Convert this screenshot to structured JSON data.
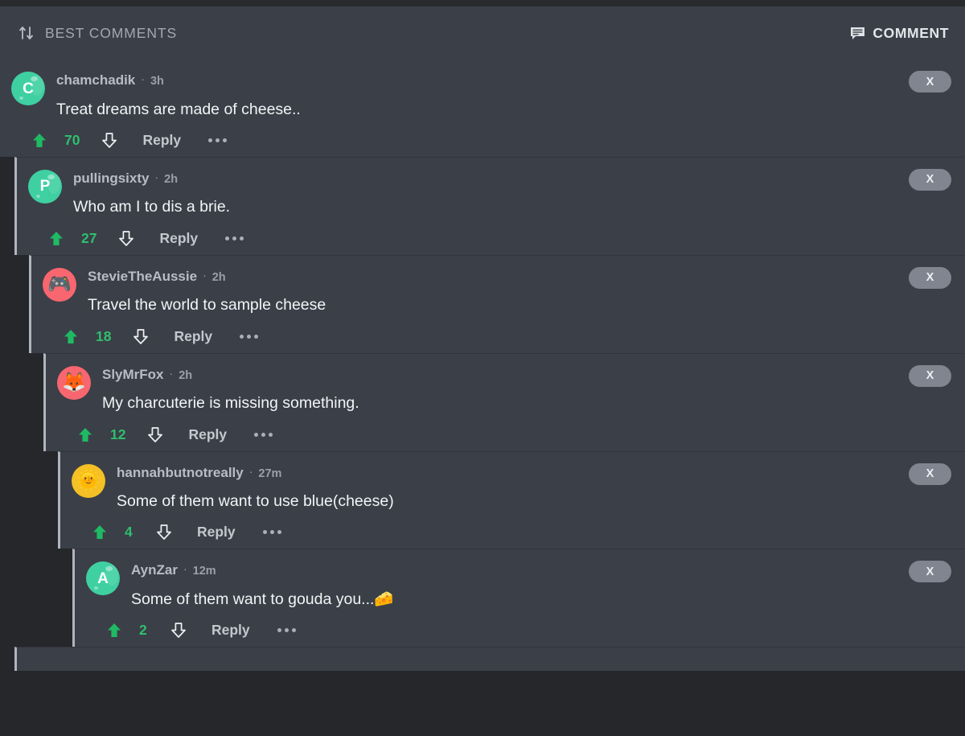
{
  "header": {
    "sort_icon": "sort-updown-icon",
    "sort_label": "BEST COMMENTS",
    "comment_icon": "comment-bubble-icon",
    "comment_label": "COMMENT"
  },
  "labels": {
    "reply": "Reply",
    "dismiss": "X",
    "upvote_icon": "upvote-arrow-icon",
    "downvote_icon": "downvote-arrow-icon",
    "more_icon": "more-options-icon",
    "separator": "·"
  },
  "colors": {
    "page_background": "#26272b",
    "comment_background": "#3b3f48",
    "indent_border": "#b0b5bd",
    "upvote_green": "#1fba63",
    "score_green": "#2fbf6d",
    "username": "#b8bdc5",
    "body_text": "#f2f4f6",
    "dismiss_pill": "#80858f"
  },
  "comments": [
    {
      "level": 0,
      "username": "chamchadik",
      "age": "3h",
      "text": "Treat dreams are made of cheese..",
      "score": "70",
      "avatar": {
        "type": "letter",
        "letter": "C",
        "background": "#3fd0a2"
      }
    },
    {
      "level": 1,
      "username": "pullingsixty",
      "age": "2h",
      "text": "Who am I to dis a brie.",
      "score": "27",
      "avatar": {
        "type": "letter",
        "letter": "P",
        "background": "#3fd0a2"
      }
    },
    {
      "level": 2,
      "username": "StevieTheAussie",
      "age": "2h",
      "text": "Travel the world to sample cheese",
      "score": "18",
      "avatar": {
        "type": "emoji",
        "emoji": "🎮",
        "background": "#f8666f"
      }
    },
    {
      "level": 3,
      "username": "SlyMrFox",
      "age": "2h",
      "text": "My charcuterie is missing something.",
      "score": "12",
      "avatar": {
        "type": "emoji",
        "emoji": "🦊",
        "background": "#f8666f"
      }
    },
    {
      "level": 4,
      "username": "hannahbutnotreally",
      "age": "27m",
      "text": "Some of them want to use blue(cheese)",
      "score": "4",
      "avatar": {
        "type": "emoji",
        "emoji": "🌞",
        "background": "#f4c025"
      }
    },
    {
      "level": 5,
      "username": "AynZar",
      "age": "12m",
      "text": "Some of them want to gouda you...🧀",
      "score": "2",
      "avatar": {
        "type": "letter",
        "letter": "A",
        "background": "#3fd0a2"
      }
    }
  ]
}
